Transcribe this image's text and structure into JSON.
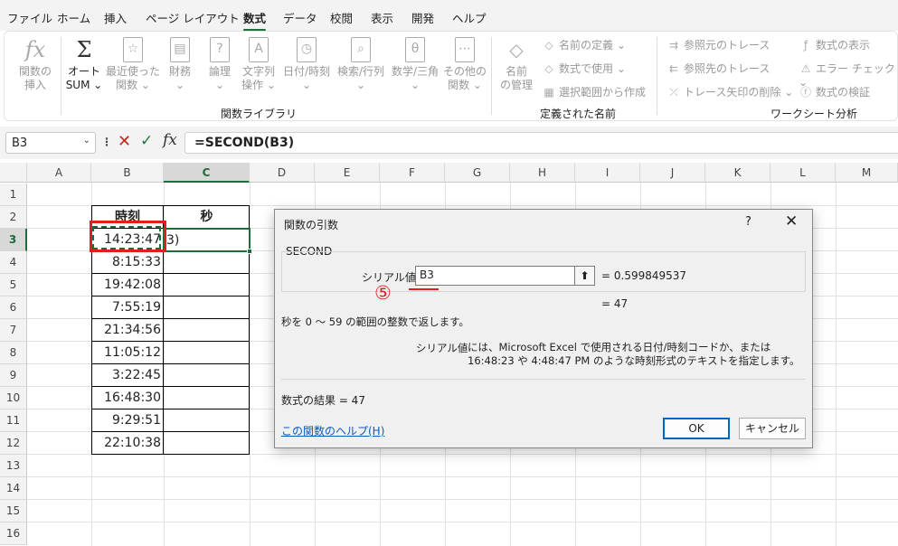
{
  "ribbon_tabs": [
    {
      "label": "ファイル",
      "active": false
    },
    {
      "label": "ホーム",
      "active": false
    },
    {
      "label": "挿入",
      "active": false
    },
    {
      "label": "ページ レイアウト",
      "active": false
    },
    {
      "label": "数式",
      "active": true
    },
    {
      "label": "データ",
      "active": false
    },
    {
      "label": "校閲",
      "active": false
    },
    {
      "label": "表示",
      "active": false
    },
    {
      "label": "開発",
      "active": false
    },
    {
      "label": "ヘルプ",
      "active": false
    }
  ],
  "ribbon": {
    "function_library": {
      "group_label": "関数ライブラリ",
      "buttons": [
        {
          "icon": "fx-icon",
          "glyph": "𝑓x",
          "label1": "関数の",
          "label2": "挿入"
        },
        {
          "icon": "sigma-icon",
          "glyph": "Σ",
          "label1": "オート",
          "label2": "SUM ⌄"
        },
        {
          "icon": "star-icon",
          "glyph": "☆",
          "label1": "最近使った",
          "label2": "関数 ⌄"
        },
        {
          "icon": "finance-icon",
          "glyph": "▤",
          "label1": "財務",
          "label2": "⌄"
        },
        {
          "icon": "logic-icon",
          "glyph": "?",
          "label1": "論理",
          "label2": "⌄"
        },
        {
          "icon": "text-icon",
          "glyph": "A",
          "label1": "文字列",
          "label2": "操作 ⌄"
        },
        {
          "icon": "clock-icon",
          "glyph": "◷",
          "label1": "日付/時刻",
          "label2": "⌄"
        },
        {
          "icon": "lookup-icon",
          "glyph": "⌕",
          "label1": "検索/行列",
          "label2": "⌄"
        },
        {
          "icon": "theta-icon",
          "glyph": "θ",
          "label1": "数学/三角",
          "label2": "⌄"
        },
        {
          "icon": "more-icon",
          "glyph": "⋯",
          "label1": "その他の",
          "label2": "関数 ⌄"
        }
      ]
    },
    "defined_names": {
      "group_label": "定義された名前",
      "name_manager": {
        "label1": "名前",
        "label2": "の管理"
      },
      "items": [
        "名前の定義 ⌄",
        "数式で使用 ⌄",
        "選択範囲から作成"
      ]
    },
    "formula_auditing": {
      "group_label": "ワークシート分析",
      "left_items": [
        "参照元のトレース",
        "参照先のトレース",
        "トレース矢印の削除 ⌄"
      ],
      "right_items": [
        "数式の表示",
        "エラー チェック ⌄",
        "数式の検証"
      ]
    }
  },
  "formula_bar": {
    "name_box": "B3",
    "fx": "fx",
    "formula": "=SECOND(B3)"
  },
  "grid": {
    "columns": [
      "A",
      "B",
      "C",
      "D",
      "E",
      "F",
      "G",
      "H",
      "I",
      "J",
      "K",
      "L",
      "M"
    ],
    "rows": [
      "1",
      "2",
      "3",
      "4",
      "5",
      "6",
      "7",
      "8",
      "9",
      "10",
      "11",
      "12",
      "13",
      "14",
      "15",
      "16"
    ],
    "headers": {
      "time": "時刻",
      "seconds": "秒"
    },
    "times": [
      "14:23:47",
      "8:15:33",
      "19:42:08",
      "7:55:19",
      "21:34:56",
      "11:05:12",
      "3:22:45",
      "16:48:30",
      "9:29:51",
      "22:10:38"
    ],
    "c3_partial": "3)"
  },
  "dialog": {
    "title": "関数の引数",
    "help_q": "?",
    "close": "✕",
    "function_name": "SECOND",
    "arg_label": "シリアル値",
    "arg_value": "B3",
    "arg_eval": "=  0.599849537",
    "result_eval": "=  47",
    "description": "秒を 0 〜 59 の範囲の整数で返します。",
    "arg_desc_label": "シリアル値",
    "arg_desc": "には、Microsoft Excel で使用される日付/時刻コードか、または 16:48:23 や 4:48:47 PM のような時刻形式のテキストを指定します。",
    "result": "数式の結果 =   47",
    "help_link": "この関数のヘルプ(H)",
    "ok": "OK",
    "cancel": "キャンセル"
  },
  "annotation": {
    "step": "⑤"
  },
  "colors": {
    "accent": "#1e6b3c",
    "annotation": "#e02020",
    "link": "#0b5ac2"
  }
}
